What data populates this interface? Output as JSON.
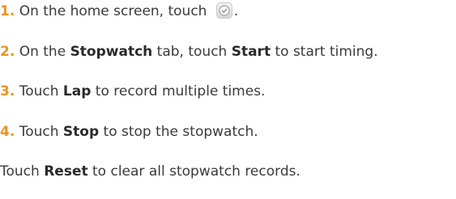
{
  "steps": [
    {
      "number": "1.",
      "text_before": " On the home screen, touch ",
      "icon": "clock-icon",
      "text_after": "."
    },
    {
      "number": "2.",
      "text_before": " On the ",
      "bold_1": "Stopwatch",
      "text_middle": " tab, touch ",
      "bold_2": "Start",
      "text_after": " to start timing."
    },
    {
      "number": "3.",
      "text_before": " Touch ",
      "bold_1": "Lap",
      "text_after": " to record multiple times."
    },
    {
      "number": "4.",
      "text_before": " Touch ",
      "bold_1": "Stop",
      "text_after": " to stop the stopwatch."
    }
  ],
  "note": {
    "text_before": "Touch ",
    "bold": "Reset",
    "text_after": " to clear all stopwatch records."
  },
  "colors": {
    "step_number": "#f0941e",
    "text": "#3a3a3a"
  }
}
